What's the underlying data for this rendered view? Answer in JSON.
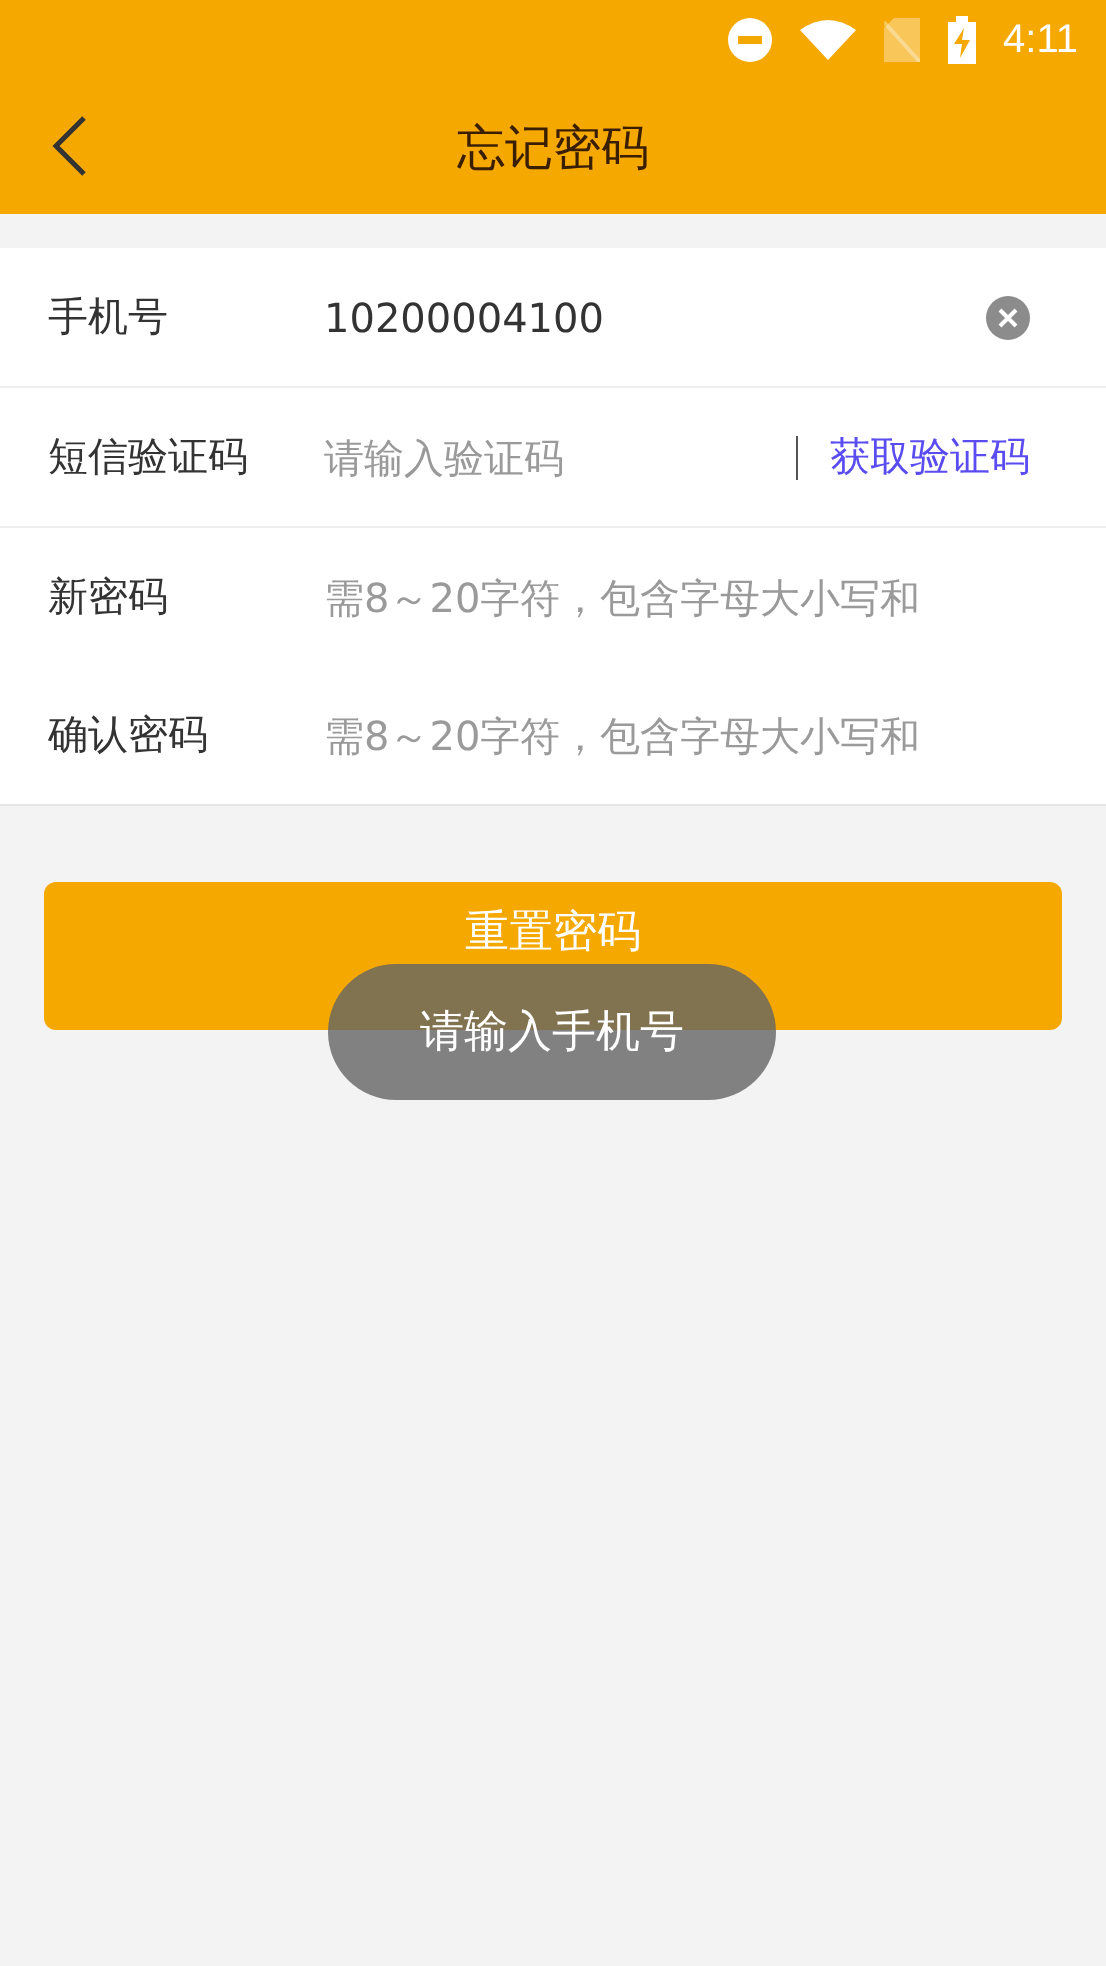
{
  "status_bar": {
    "time": "4:11"
  },
  "header": {
    "title": "忘记密码"
  },
  "fields": [
    {
      "kind": "phone",
      "label": "手机号",
      "value": "10200004100"
    },
    {
      "kind": "code",
      "label": "短信验证码",
      "placeholder": "请输入验证码",
      "action": "获取验证码"
    },
    {
      "kind": "password",
      "label": "新密码",
      "placeholder": "需8～20字符，包含字母大小写和"
    },
    {
      "kind": "password",
      "label": "确认密码",
      "placeholder": "需8～20字符，包含字母大小写和"
    }
  ],
  "submit": {
    "label": "重置密码"
  },
  "toast": {
    "text": "请输入手机号"
  }
}
